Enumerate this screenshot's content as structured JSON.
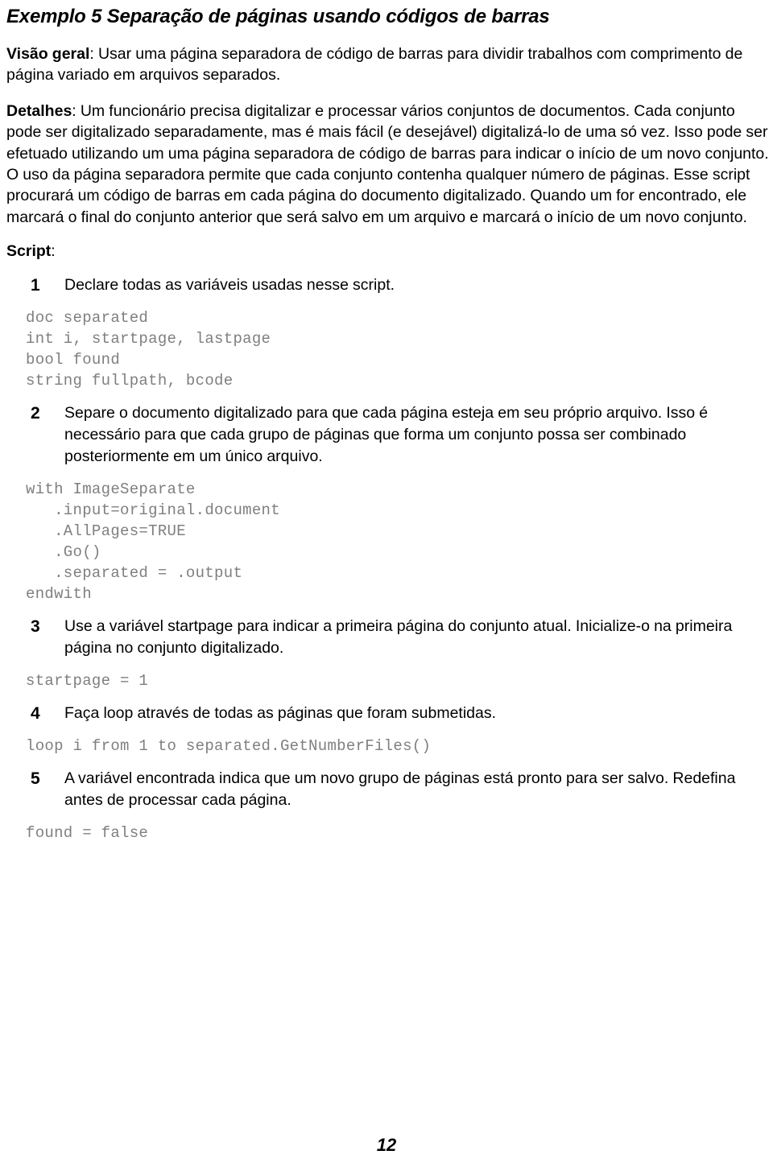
{
  "document": {
    "title": "Exemplo 5 Separação de páginas usando códigos de barras",
    "page_number": "12",
    "code_color": "#7f7f7f",
    "text_color": "#000000",
    "background_color": "#ffffff"
  },
  "overview": {
    "label": "Visão geral",
    "separator": ": ",
    "body": "Usar uma página separadora de código de barras para dividir trabalhos com comprimento de página variado em arquivos separados."
  },
  "details": {
    "label": "Detalhes",
    "separator": ": ",
    "body": "Um funcionário precisa digitalizar e processar vários conjuntos de documentos. Cada conjunto pode ser digitalizado separadamente, mas é mais fácil (e desejável) digitalizá-lo de uma só vez. Isso pode ser efetuado utilizando um uma página separadora de código de barras para indicar o início de um novo conjunto. O uso da página separadora permite que cada conjunto contenha qualquer número de páginas. Esse script procurará um código de barras em cada página do documento digitalizado. Quando um for encontrado, ele marcará o final do conjunto anterior que será salvo em um arquivo e marcará o início de um novo conjunto."
  },
  "script_section": {
    "label": "Script",
    "separator": ":"
  },
  "steps": [
    {
      "number": "1",
      "text": "Declare todas as variáveis usadas nesse script.",
      "code": "doc separated\nint i, startpage, lastpage\nbool found\nstring fullpath, bcode"
    },
    {
      "number": "2",
      "text": "Separe o documento digitalizado para que cada página esteja em seu próprio arquivo. Isso é necessário para que cada grupo de páginas que forma um conjunto possa ser combinado posteriormente em um único arquivo.",
      "code": "with ImageSeparate\n   .input=original.document\n   .AllPages=TRUE\n   .Go()\n   .separated = .output\nendwith"
    },
    {
      "number": "3",
      "text": "Use a variável startpage para indicar a primeira página do conjunto atual. Inicialize-o na primeira página no conjunto digitalizado.",
      "code": "startpage = 1"
    },
    {
      "number": "4",
      "text": "Faça loop através de todas as páginas que foram submetidas.",
      "code": "loop i from 1 to separated.GetNumberFiles()"
    },
    {
      "number": "5",
      "text": "A variável encontrada indica que um novo grupo de páginas está pronto para ser salvo. Redefina antes de processar cada página.",
      "code": "found = false"
    }
  ]
}
